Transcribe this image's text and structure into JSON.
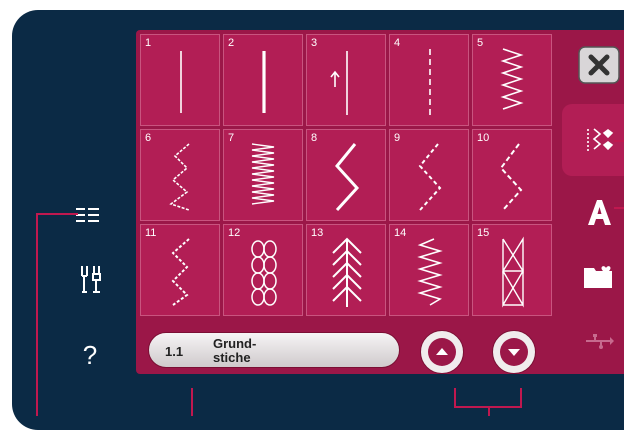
{
  "stitches": [
    {
      "id": "1",
      "label": "1"
    },
    {
      "id": "2",
      "label": "2"
    },
    {
      "id": "3",
      "label": "3"
    },
    {
      "id": "4",
      "label": "4"
    },
    {
      "id": "5",
      "label": "5"
    },
    {
      "id": "6",
      "label": "6"
    },
    {
      "id": "7",
      "label": "7"
    },
    {
      "id": "8",
      "label": "8"
    },
    {
      "id": "9",
      "label": "9"
    },
    {
      "id": "10",
      "label": "10"
    },
    {
      "id": "11",
      "label": "11"
    },
    {
      "id": "12",
      "label": "12"
    },
    {
      "id": "13",
      "label": "13"
    },
    {
      "id": "14",
      "label": "14"
    },
    {
      "id": "15",
      "label": "15"
    }
  ],
  "category": {
    "number": "1.1",
    "name": "Grund-\nstiche"
  },
  "left_icons": {
    "menu": "≡≡",
    "tools": "tools",
    "help": "?"
  },
  "icons": [
    "close-icon",
    "stitch-menu-icon",
    "letter-a-icon",
    "folder-heart-icon",
    "usb-icon",
    "scroll-up-icon",
    "scroll-down-icon"
  ],
  "colors": {
    "background": "#0b2a45",
    "panel": "#9b1748",
    "cell": "#b21e55",
    "stitch": "#ffffff",
    "callout": "#c0184f"
  }
}
